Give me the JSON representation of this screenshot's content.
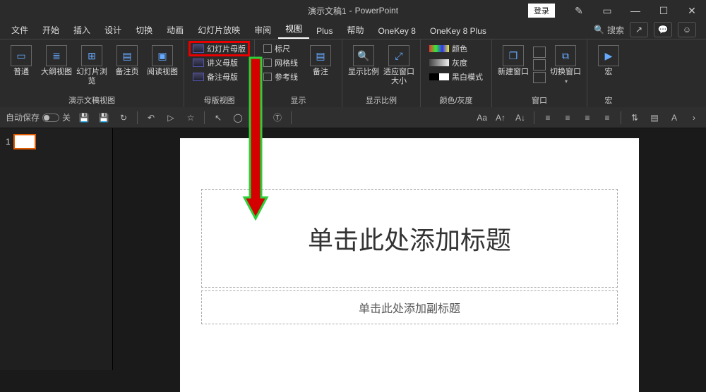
{
  "titlebar": {
    "doc_name": "演示文稿1",
    "app_name": "PowerPoint",
    "login": "登录"
  },
  "tabs": {
    "file": "文件",
    "home": "开始",
    "insert": "插入",
    "design": "设计",
    "transitions": "切换",
    "animations": "动画",
    "slideshow": "幻灯片放映",
    "review": "审阅",
    "view": "视图",
    "plus": "Plus",
    "help": "帮助",
    "onekey8": "OneKey 8",
    "onekey8plus": "OneKey 8 Plus",
    "search": "搜索"
  },
  "ribbon": {
    "presentation_views": {
      "normal": "普通",
      "outline": "大纲视图",
      "sorter": "幻灯片浏览",
      "notes": "备注页",
      "reading": "阅读视图",
      "group_label": "演示文稿视图"
    },
    "master_views": {
      "slide_master": "幻灯片母版",
      "handout_master": "讲义母版",
      "notes_master": "备注母版",
      "group_label": "母版视图"
    },
    "show": {
      "ruler": "标尺",
      "gridlines": "网格线",
      "guides": "参考线",
      "notes": "备注",
      "group_label": "显示"
    },
    "zoom": {
      "zoom": "显示比例",
      "fit": "适应窗口大小",
      "group_label": "显示比例"
    },
    "color_gray": {
      "color": "颜色",
      "gray": "灰度",
      "blackwhite": "黑白模式",
      "group_label": "颜色/灰度"
    },
    "window": {
      "new_window": "新建窗口",
      "switch": "切换窗口",
      "group_label": "窗口"
    },
    "macros": {
      "macros": "宏",
      "group_label": "宏"
    }
  },
  "qat": {
    "autosave": "自动保存",
    "autosave_state": "关"
  },
  "slide": {
    "thumb_number": "1",
    "title_placeholder": "单击此处添加标题",
    "subtitle_placeholder": "单击此处添加副标题"
  }
}
